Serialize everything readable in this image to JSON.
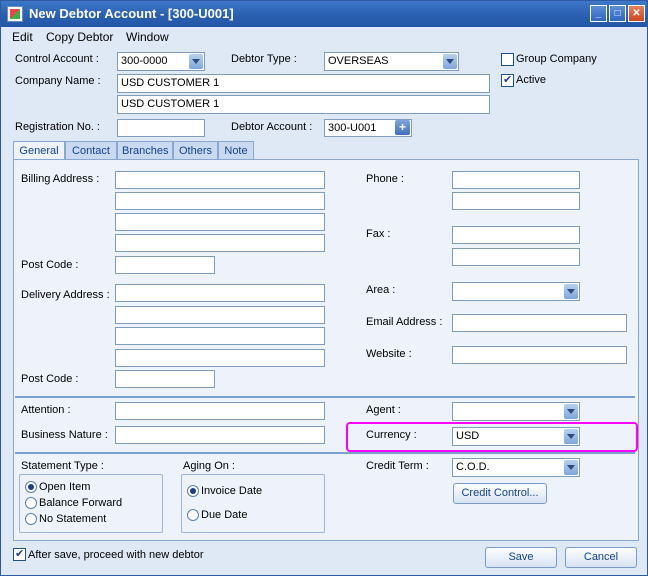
{
  "window": {
    "title": "New Debtor Account - [300-U001]"
  },
  "menu": {
    "items": [
      "Edit",
      "Copy Debtor",
      "Window"
    ]
  },
  "header": {
    "control_account_label": "Control Account :",
    "control_account_value": "300-0000",
    "debtor_type_label": "Debtor Type :",
    "debtor_type_value": "OVERSEAS",
    "group_company_label": "Group Company",
    "group_company_checked": false,
    "active_label": "Active",
    "active_checked": true,
    "company_name_label": "Company Name :",
    "company_name_1": "USD CUSTOMER 1",
    "company_name_2": "USD CUSTOMER 1",
    "registration_label": "Registration No. :",
    "registration_value": "",
    "debtor_account_label": "Debtor Account :",
    "debtor_account_value": "300-U001"
  },
  "tabs": [
    "General",
    "Contact",
    "Branches",
    "Others",
    "Note"
  ],
  "general": {
    "billing_address_label": "Billing Address :",
    "post_code_label": "Post Code :",
    "delivery_address_label": "Delivery Address :",
    "post_code2_label": "Post Code :",
    "phone_label": "Phone :",
    "fax_label": "Fax :",
    "area_label": "Area :",
    "email_label": "Email  Address :",
    "website_label": "Website :",
    "attention_label": "Attention :",
    "business_nature_label": "Business Nature :",
    "agent_label": "Agent :",
    "currency_label": "Currency :",
    "currency_value": "USD",
    "statement_type_label": "Statement Type :",
    "statement_options": [
      "Open Item",
      "Balance Forward",
      "No Statement"
    ],
    "statement_selected": "Open Item",
    "aging_on_label": "Aging On :",
    "aging_options": [
      "Invoice Date",
      "Due Date"
    ],
    "aging_selected": "Invoice Date",
    "credit_term_label": "Credit Term :",
    "credit_term_value": "C.O.D.",
    "credit_control_button": "Credit Control..."
  },
  "footer": {
    "proceed_label": "After save, proceed with new debtor",
    "proceed_checked": true,
    "save_button": "Save",
    "cancel_button": "Cancel"
  }
}
